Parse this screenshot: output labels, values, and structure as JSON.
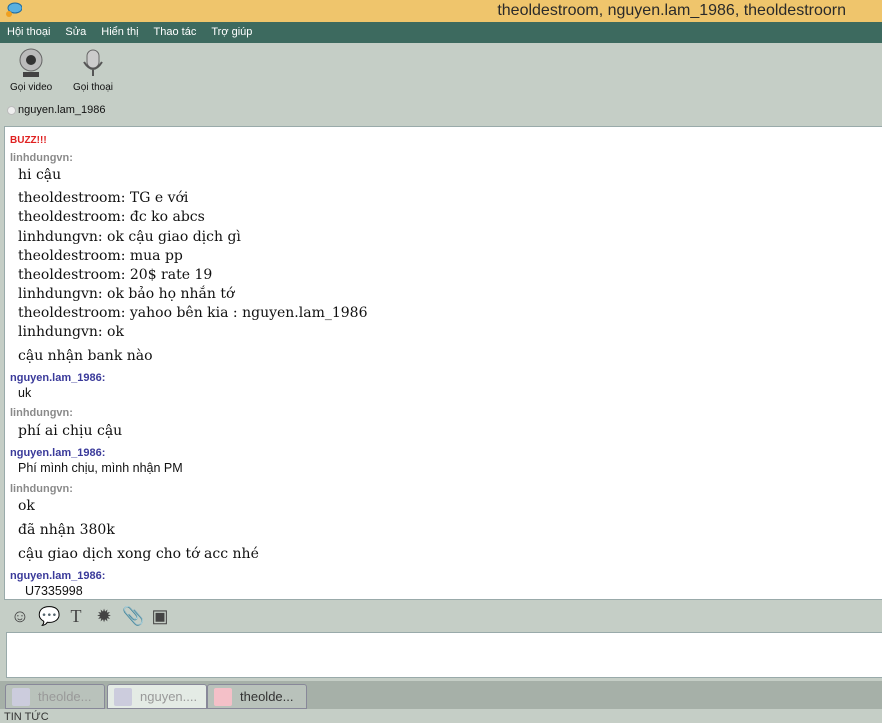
{
  "window": {
    "title": "theoldestroom, nguyen.lam_1986, theoldestroorn"
  },
  "menu": [
    "Hội thoại",
    "Sửa",
    "Hiển thị",
    "Thao tác",
    "Trợ giúp"
  ],
  "toolbar": {
    "video": "Gọi video",
    "voice": "Gọi thoại"
  },
  "contact": "nguyen.lam_1986",
  "messages": [
    {
      "t": "sys",
      "text": "BUZZ!!!"
    },
    {
      "t": "nm-l",
      "text": "linhdungvn:"
    },
    {
      "t": "serif",
      "text": "hi cậu"
    },
    {
      "t": "serif",
      "text": "theoldestroom: TG e với"
    },
    {
      "t": "serif",
      "text": "theoldestroom: đc ko abcs"
    },
    {
      "t": "serif",
      "text": "linhdungvn: ok cậu giao dịch gì"
    },
    {
      "t": "serif",
      "text": "theoldestroom: mua pp"
    },
    {
      "t": "serif",
      "text": "theoldestroom: 20$ rate 19"
    },
    {
      "t": "serif",
      "text": "linhdungvn: ok bảo họ nhắn tớ"
    },
    {
      "t": "serif",
      "text": "theoldestroom: yahoo bên kia : nguyen.lam_1986"
    },
    {
      "t": "serif",
      "text": "linhdungvn: ok"
    },
    {
      "t": "serif",
      "text": "cậu nhận bank nào"
    },
    {
      "t": "nm-n",
      "text": "nguyen.lam_1986:"
    },
    {
      "t": "sans",
      "text": "uk"
    },
    {
      "t": "nm-l",
      "text": "linhdungvn:"
    },
    {
      "t": "serif",
      "text": "phí ai chịu cậu"
    },
    {
      "t": "nm-n",
      "text": "nguyen.lam_1986:"
    },
    {
      "t": "sans",
      "text": "Phí mình chịu, mình nhận PM"
    },
    {
      "t": "nm-l",
      "text": "linhdungvn:"
    },
    {
      "t": "serif",
      "text": "ok"
    },
    {
      "t": "serif",
      "text": "đã nhận 380k"
    },
    {
      "t": "serif",
      "text": "cậu giao dịch xong cho tớ acc nhé"
    },
    {
      "t": "nm-n",
      "text": "nguyen.lam_1986:"
    },
    {
      "t": "sans",
      "text": "U7335998"
    }
  ],
  "format_icons": [
    "smiley-icon",
    "voice-bubble-icon",
    "text-format-icon",
    "buzz-icon",
    "attachment-icon",
    "image-icon"
  ],
  "tabs": [
    "theolde...",
    "nguyen....",
    "theolde..."
  ],
  "news": "TIN TỨC"
}
